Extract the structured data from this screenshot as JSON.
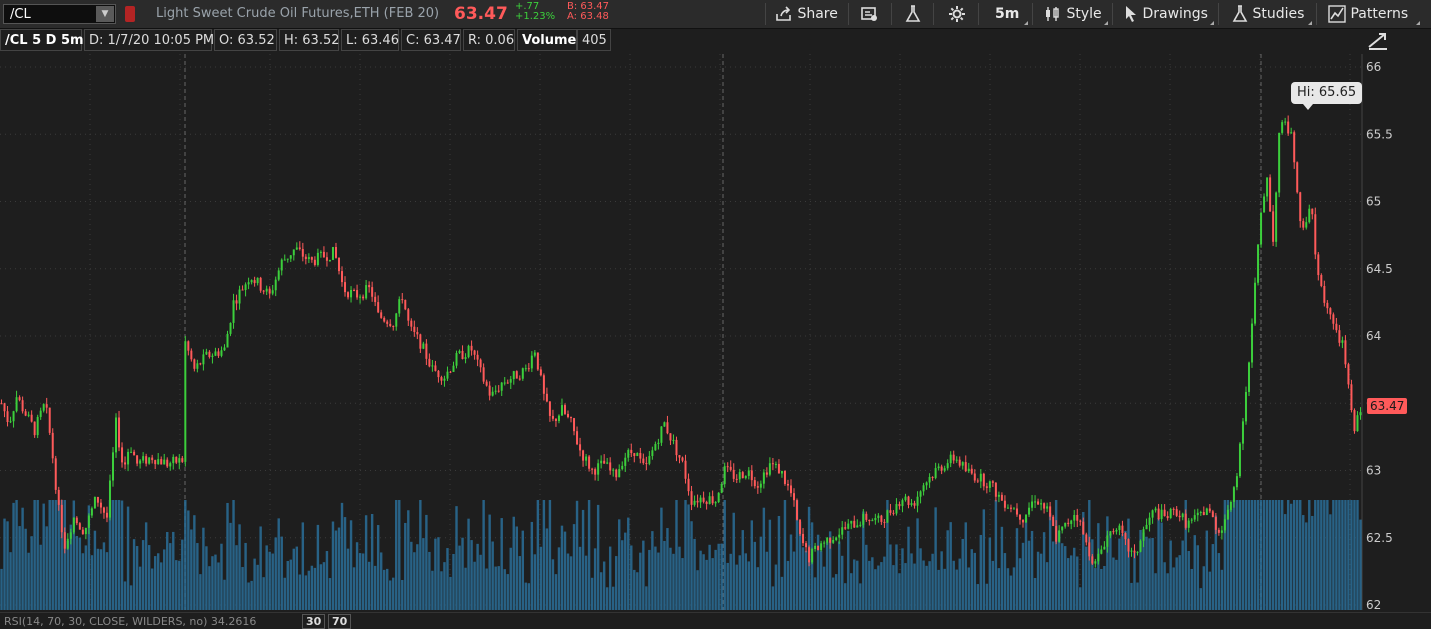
{
  "toolbar": {
    "symbol": "/CL",
    "instrument": "Light Sweet Crude Oil Futures,ETH (FEB 20)",
    "last": "63.47",
    "net_change": "+.77",
    "pct_change": "+1.23%",
    "bid": "B: 63.47",
    "ask": "A: 63.48",
    "share_label": "Share",
    "timeframe_label": "5m",
    "style_label": "Style",
    "drawings_label": "Drawings",
    "studies_label": "Studies",
    "patterns_label": "Patterns"
  },
  "infobar": {
    "title": "/CL 5 D 5m",
    "date": "D: 1/7/20 10:05 PM",
    "open": "O: 63.52",
    "high": "H: 63.52",
    "low": "L: 63.46",
    "close": "C: 63.47",
    "range": "R: 0.06",
    "volume_label": "Volume",
    "volume_value": "405"
  },
  "rsi": {
    "label": "RSI(14, 70, 30, CLOSE, WILDERS, no)",
    "value": "34.2616",
    "overbought": "30",
    "oversold": "70"
  },
  "hi_label": "Hi: 65.65",
  "price_tag": "63.47",
  "colors": {
    "up": "#3ccf3c",
    "down": "#ff5a5a",
    "volume": "#2a6f99",
    "background": "#1e1e1e",
    "grid": "#3a3a3a"
  },
  "chart_data": {
    "type": "candlestick",
    "title": "/CL 5 D 5m",
    "y_ticks": [
      62,
      62.5,
      63,
      63.5,
      64,
      64.5,
      65,
      65.5,
      66
    ],
    "ylim": [
      62,
      66
    ],
    "last_price": 63.47,
    "high_marker": 65.65,
    "price_path": [
      [
        0,
        63.5
      ],
      [
        0.5,
        63.35
      ],
      [
        1,
        63.55
      ],
      [
        1.7,
        63.4
      ],
      [
        2.2,
        63.3
      ],
      [
        2.9,
        63.5
      ],
      [
        3.3,
        63.2
      ],
      [
        3.8,
        62.7
      ],
      [
        4.2,
        62.45
      ],
      [
        4.8,
        62.65
      ],
      [
        5.5,
        62.55
      ],
      [
        6.3,
        62.8
      ],
      [
        7.0,
        62.65
      ],
      [
        7.6,
        63.35
      ],
      [
        8.1,
        63.0
      ],
      [
        8.5,
        63.2
      ],
      [
        9.0,
        63.05
      ],
      [
        10.0,
        63.1
      ],
      [
        11.0,
        63.05
      ],
      [
        12.1,
        63.08
      ],
      [
        12.2,
        63.95
      ],
      [
        12.8,
        63.75
      ],
      [
        13.6,
        63.85
      ],
      [
        14.8,
        63.9
      ],
      [
        15.4,
        64.25
      ],
      [
        16.5,
        64.45
      ],
      [
        17.8,
        64.3
      ],
      [
        18.6,
        64.55
      ],
      [
        19.5,
        64.65
      ],
      [
        20.5,
        64.55
      ],
      [
        21.5,
        64.6
      ],
      [
        22.1,
        64.62
      ],
      [
        22.7,
        64.35
      ],
      [
        23.5,
        64.3
      ],
      [
        24.5,
        64.35
      ],
      [
        25.0,
        64.15
      ],
      [
        26.0,
        64.1
      ],
      [
        26.6,
        64.3
      ],
      [
        27.1,
        64.05
      ],
      [
        27.8,
        63.95
      ],
      [
        28.6,
        63.75
      ],
      [
        29.4,
        63.7
      ],
      [
        30.3,
        63.85
      ],
      [
        31.2,
        63.9
      ],
      [
        31.9,
        63.7
      ],
      [
        32.5,
        63.55
      ],
      [
        33.2,
        63.65
      ],
      [
        34.0,
        63.7
      ],
      [
        34.8,
        63.75
      ],
      [
        35.4,
        63.9
      ],
      [
        36.0,
        63.55
      ],
      [
        36.5,
        63.35
      ],
      [
        37.2,
        63.45
      ],
      [
        37.8,
        63.35
      ],
      [
        38.4,
        63.15
      ],
      [
        39.2,
        63.0
      ],
      [
        40.0,
        63.05
      ],
      [
        40.7,
        62.95
      ],
      [
        41.3,
        63.1
      ],
      [
        42.0,
        63.15
      ],
      [
        42.7,
        63.0
      ],
      [
        43.4,
        63.2
      ],
      [
        44.0,
        63.35
      ],
      [
        44.6,
        63.2
      ],
      [
        45.2,
        63.05
      ],
      [
        45.8,
        62.78
      ],
      [
        46.6,
        62.8
      ],
      [
        47.4,
        62.78
      ],
      [
        48.0,
        63.0
      ],
      [
        48.8,
        62.95
      ],
      [
        49.5,
        63.0
      ],
      [
        50.2,
        62.9
      ],
      [
        51.0,
        63.05
      ],
      [
        51.7,
        63.0
      ],
      [
        52.5,
        62.8
      ],
      [
        53.0,
        62.5
      ],
      [
        53.6,
        62.35
      ],
      [
        54.3,
        62.45
      ],
      [
        55.0,
        62.5
      ],
      [
        55.7,
        62.55
      ],
      [
        56.5,
        62.6
      ],
      [
        57.4,
        62.65
      ],
      [
        58.3,
        62.62
      ],
      [
        59.0,
        62.7
      ],
      [
        59.8,
        62.8
      ],
      [
        60.5,
        62.75
      ],
      [
        61.2,
        62.9
      ],
      [
        62.0,
        63.0
      ],
      [
        62.6,
        63.05
      ],
      [
        63.3,
        63.1
      ],
      [
        64.0,
        63.0
      ],
      [
        64.8,
        62.95
      ],
      [
        65.6,
        62.9
      ],
      [
        66.4,
        62.78
      ],
      [
        67.2,
        62.72
      ],
      [
        67.8,
        62.65
      ],
      [
        68.6,
        62.8
      ],
      [
        69.4,
        62.7
      ],
      [
        70.0,
        62.5
      ],
      [
        70.7,
        62.6
      ],
      [
        71.3,
        62.7
      ],
      [
        72.0,
        62.45
      ],
      [
        72.6,
        62.3
      ],
      [
        73.3,
        62.5
      ],
      [
        74.0,
        62.6
      ],
      [
        74.6,
        62.45
      ],
      [
        75.2,
        62.35
      ],
      [
        75.8,
        62.55
      ],
      [
        76.5,
        62.7
      ],
      [
        77.2,
        62.65
      ],
      [
        78.0,
        62.7
      ],
      [
        78.7,
        62.6
      ],
      [
        79.4,
        62.65
      ],
      [
        80.0,
        62.72
      ],
      [
        80.8,
        62.55
      ],
      [
        81.5,
        62.7
      ],
      [
        82.0,
        63.0
      ],
      [
        82.8,
        63.8
      ],
      [
        83.5,
        64.8
      ],
      [
        84.0,
        65.2
      ],
      [
        84.4,
        64.7
      ],
      [
        84.8,
        65.5
      ],
      [
        85.2,
        65.6
      ],
      [
        85.7,
        65.45
      ],
      [
        86.1,
        64.9
      ],
      [
        86.5,
        64.75
      ],
      [
        86.9,
        65.0
      ],
      [
        87.3,
        64.5
      ],
      [
        87.7,
        64.3
      ],
      [
        88.1,
        64.2
      ],
      [
        88.6,
        64.0
      ],
      [
        89.0,
        63.95
      ],
      [
        89.4,
        63.6
      ],
      [
        89.8,
        63.3
      ],
      [
        90.2,
        63.47
      ]
    ]
  }
}
